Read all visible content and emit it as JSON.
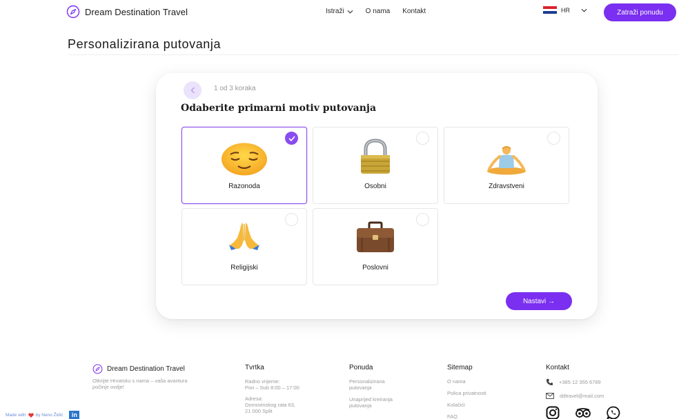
{
  "header": {
    "brand": "Dream Destination Travel",
    "nav": [
      "Istraži",
      "O nama",
      "Kontakt"
    ],
    "language": "HR",
    "cta": "Zatraži ponudu"
  },
  "page_title": "Personalizirana putovanja",
  "wizard": {
    "step": "1 od 3 koraka",
    "question": "Odaberite primarni motiv putovanja",
    "options": [
      {
        "label": "Razonoda",
        "icon": "relieved-face-icon",
        "selected": true
      },
      {
        "label": "Osobni",
        "icon": "padlock-icon",
        "selected": false
      },
      {
        "label": "Zdravstveni",
        "icon": "yoga-person-icon",
        "selected": false
      },
      {
        "label": "Religijski",
        "icon": "praying-hands-icon",
        "selected": false
      },
      {
        "label": "Poslovni",
        "icon": "briefcase-icon",
        "selected": false
      }
    ],
    "next": "Nastavi →"
  },
  "footer": {
    "brand": "Dream Destination Travel",
    "tagline": "Otkrijte Hrvatsku s nama – vaša avantura počinje ovdje!",
    "company": {
      "title": "Tvrtka",
      "hours_label": "Radno vrijeme:",
      "hours": "Pon – Sub 8:00 – 17:00",
      "address_label": "Adresa:",
      "address1": "Domovinskog rata 63,",
      "address2": "21 000 Split"
    },
    "offer": {
      "title": "Ponuda",
      "links": [
        "Personalizirana putovanja",
        "Unaprijed kreiranja putovanja"
      ]
    },
    "sitemap": {
      "title": "Sitemap",
      "links": [
        "O nama",
        "Polica privatnosti",
        "Kolačići",
        "FAQ"
      ]
    },
    "contact": {
      "title": "Kontakt",
      "phone": "+385 12 355 6789",
      "email": "ddtravel@mail.com"
    }
  },
  "madewith": {
    "prefix": "Made with",
    "suffix": "by Neno Židić",
    "linkedin": "in"
  },
  "colors": {
    "accent": "#7b2ff0",
    "selected_border": "#8a4cf0"
  }
}
